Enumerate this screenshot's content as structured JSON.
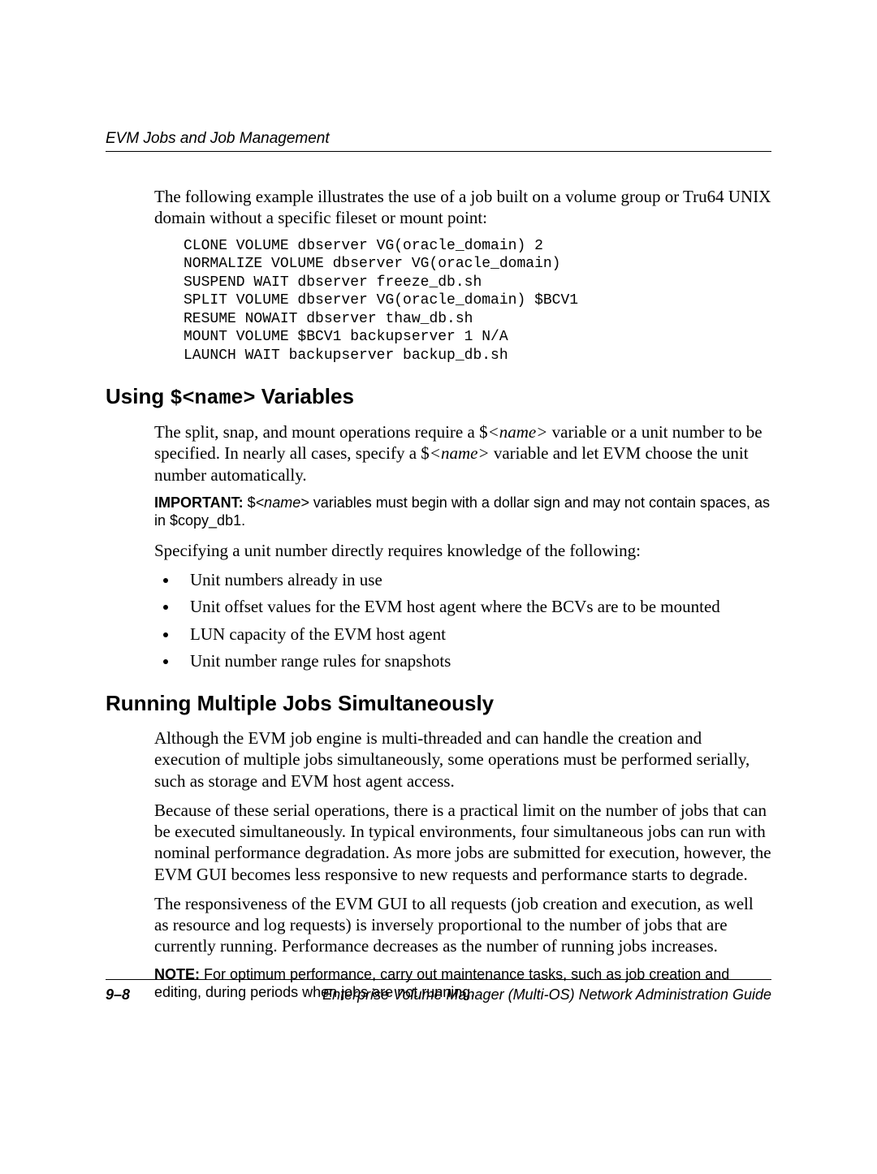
{
  "header": {
    "chapterTitle": "EVM Jobs and Job Management"
  },
  "intro": {
    "p1": "The following example illustrates the use of a job built on a volume group or Tru64 UNIX domain without a specific fileset or mount point:"
  },
  "code": {
    "block": "CLONE VOLUME dbserver VG(oracle_domain) 2\nNORMALIZE VOLUME dbserver VG(oracle_domain)\nSUSPEND WAIT dbserver freeze_db.sh\nSPLIT VOLUME dbserver VG(oracle_domain) $BCV1\nRESUME NOWAIT dbserver thaw_db.sh\nMOUNT VOLUME $BCV1 backupserver 1 N/A\nLAUNCH WAIT backupserver backup_db.sh"
  },
  "section1": {
    "title_pre": "Using ",
    "title_code": "$<name>",
    "title_post": " Variables",
    "p1_a": "The split, snap, and mount operations require a $",
    "p1_var": "<name>",
    "p1_b": " variable or a unit number to be specified. In nearly all cases, specify a $",
    "p1_var2": "<name>",
    "p1_c": " variable and let EVM choose the unit number automatically.",
    "important_label": "IMPORTANT:",
    "important_a": "  $",
    "important_var": "<name>",
    "important_b": " variables must begin with a dollar sign and may not contain spaces, as in $copy_db1.",
    "p2": "Specifying a unit number directly requires knowledge of the following:",
    "bullets": [
      "Unit numbers already in use",
      "Unit offset values for the EVM host agent where the BCVs are to be mounted",
      "LUN capacity of the EVM host agent",
      "Unit number range rules for snapshots"
    ]
  },
  "section2": {
    "title": "Running Multiple Jobs Simultaneously",
    "p1": "Although the EVM job engine is multi-threaded and can handle the creation and execution of multiple jobs simultaneously, some operations must be performed serially, such as storage and EVM host agent access.",
    "p2": "Because of these serial operations, there is a practical limit on the number of jobs that can be executed simultaneously. In typical environments, four simultaneous jobs can run with nominal performance degradation. As more jobs are submitted for execution, however, the EVM GUI becomes less responsive to new requests and performance starts to degrade.",
    "p3": "The responsiveness of the EVM GUI to all requests (job creation and execution, as well as resource and log requests) is inversely proportional to the number of jobs that are currently running. Performance decreases as the number of running jobs increases.",
    "note_label": "NOTE:",
    "note_text": "  For optimum performance, carry out maintenance tasks, such as job creation and editing, during periods when jobs are not running."
  },
  "footer": {
    "page": "9–8",
    "book": "Enterprise Volume Manager (Multi-OS) Network Administration Guide"
  }
}
